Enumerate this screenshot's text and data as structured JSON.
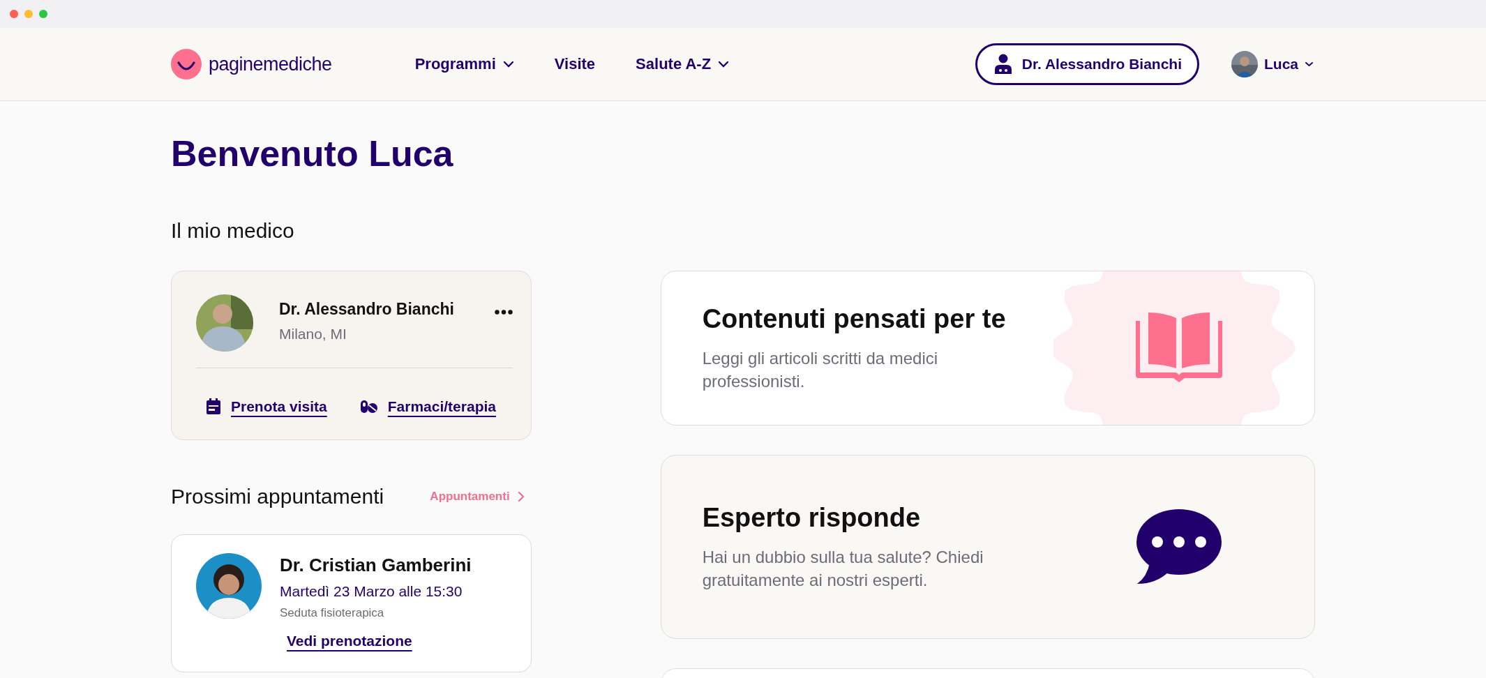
{
  "header": {
    "logo": "paginemediche",
    "nav": [
      {
        "label": "Programmi",
        "dropdown": true
      },
      {
        "label": "Visite",
        "dropdown": false
      },
      {
        "label": "Salute A-Z",
        "dropdown": true
      }
    ],
    "doctor_button": "Dr. Alessandro Bianchi",
    "user": {
      "name": "Luca",
      "dropdown": true
    }
  },
  "title": "Benvenuto Luca",
  "my_doctor": {
    "heading": "Il mio medico",
    "name": "Dr. Alessandro Bianchi",
    "location": "Milano, MI",
    "actions": [
      {
        "label": "Prenota visita",
        "kind": "calendar"
      },
      {
        "label": "Farmaci/terapia",
        "kind": "pills"
      }
    ]
  },
  "appointments": {
    "heading": "Prossimi appuntamenti",
    "link": "Appuntamenti",
    "items": [
      {
        "doctor": "Dr. Cristian Gamberini",
        "when": "Martedì 23 Marzo alle 15:30",
        "type": "Seduta fisioterapica",
        "link": "Vedi prenotazione"
      }
    ]
  },
  "cards": [
    {
      "kind": "book",
      "title": "Contenuti pensati per te",
      "text": "Leggi gli articoli scritti da medici professionisti."
    },
    {
      "kind": "chat",
      "title": "Esperto risponde",
      "text": "Hai un dubbio sulla tua salute? Chiedi gratuitamente ai nostri esperti."
    }
  ]
}
